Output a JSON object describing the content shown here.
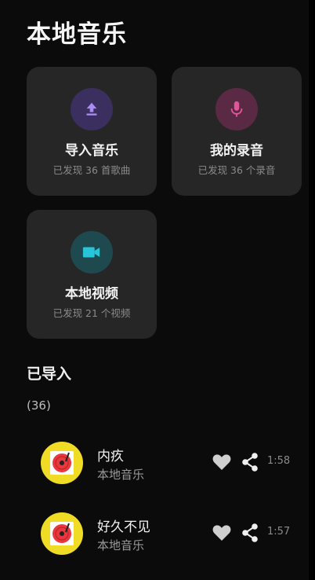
{
  "header": {
    "title": "本地音乐"
  },
  "cards": [
    {
      "title": "导入音乐",
      "subtitle": "已发现 36 首歌曲",
      "icon": "upload-icon",
      "icon_bg": "#3b2f5f",
      "icon_color": "#a98df0"
    },
    {
      "title": "我的录音",
      "subtitle": "已发现 36 个录音",
      "icon": "microphone-icon",
      "icon_bg": "#5a2a45",
      "icon_color": "#e0569a"
    },
    {
      "title": "本地视频",
      "subtitle": "已发现 21 个视频",
      "icon": "video-camera-icon",
      "icon_bg": "#1e4a4f",
      "icon_color": "#28c4d8"
    }
  ],
  "imported": {
    "title": "已导入",
    "count": "(36)",
    "songs": [
      {
        "title": "内疚",
        "source": "本地音乐",
        "duration": "1:58"
      },
      {
        "title": "好久不见",
        "source": "本地音乐",
        "duration": "1:57"
      }
    ]
  },
  "colors": {
    "background": "#0b0b0b",
    "card": "#262626",
    "album_yellow": "#f1dc25",
    "album_red": "#e8383d",
    "icon_grey": "#cfcfcf"
  }
}
